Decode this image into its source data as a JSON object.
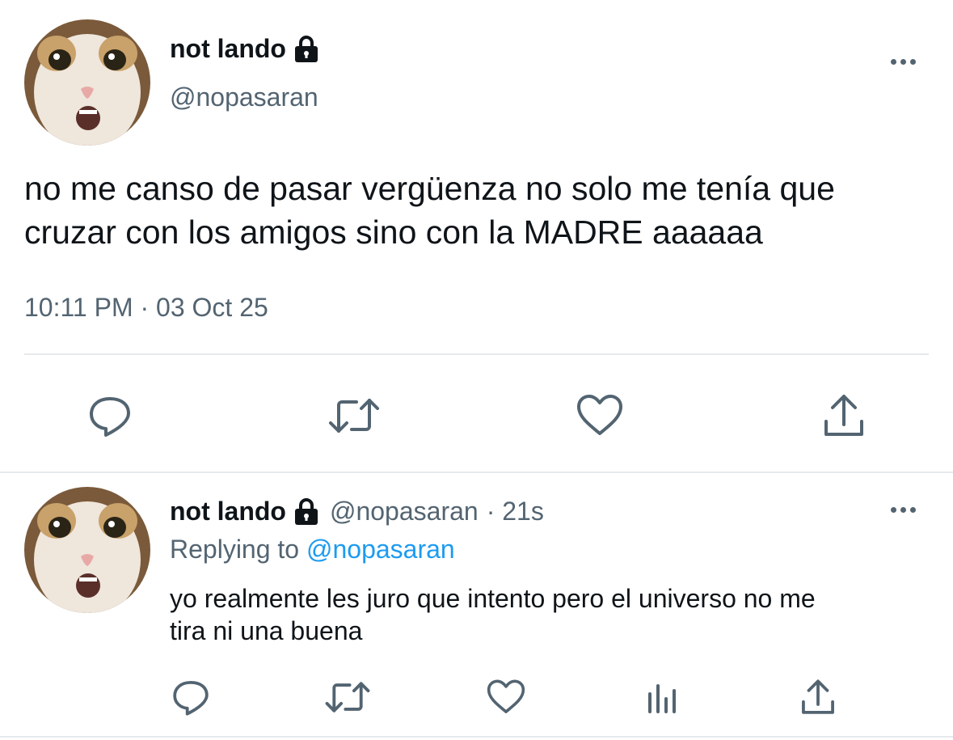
{
  "main_tweet": {
    "author_name": "not lando",
    "author_handle": "@nopasaran",
    "text_line1": "no me canso de pasar vergüenza no solo me tenía que",
    "text_line2": "cruzar con los amigos sino con la MADRE aaaaaa",
    "timestamp": "10:11 PM · 03 Oct 25",
    "icons": [
      "lock-icon",
      "more-icon",
      "reply-icon",
      "retweet-icon",
      "like-icon",
      "share-icon"
    ]
  },
  "reply_tweet": {
    "author_name": "not lando",
    "author_handle": "@nopasaran",
    "time_ago": "· 21s",
    "replying_prefix": "Replying to",
    "replying_handle": "@nopasaran",
    "text_line1": "yo realmente les juro que intento pero el universo no me",
    "text_line2": "tira ni una buena",
    "icons": [
      "lock-icon",
      "more-icon",
      "reply-icon",
      "retweet-icon",
      "like-icon",
      "analytics-icon",
      "share-icon"
    ]
  },
  "colors": {
    "text": "#0f1419",
    "muted": "#536471",
    "link": "#1d9bf0",
    "divider": "#e6e9ec"
  }
}
